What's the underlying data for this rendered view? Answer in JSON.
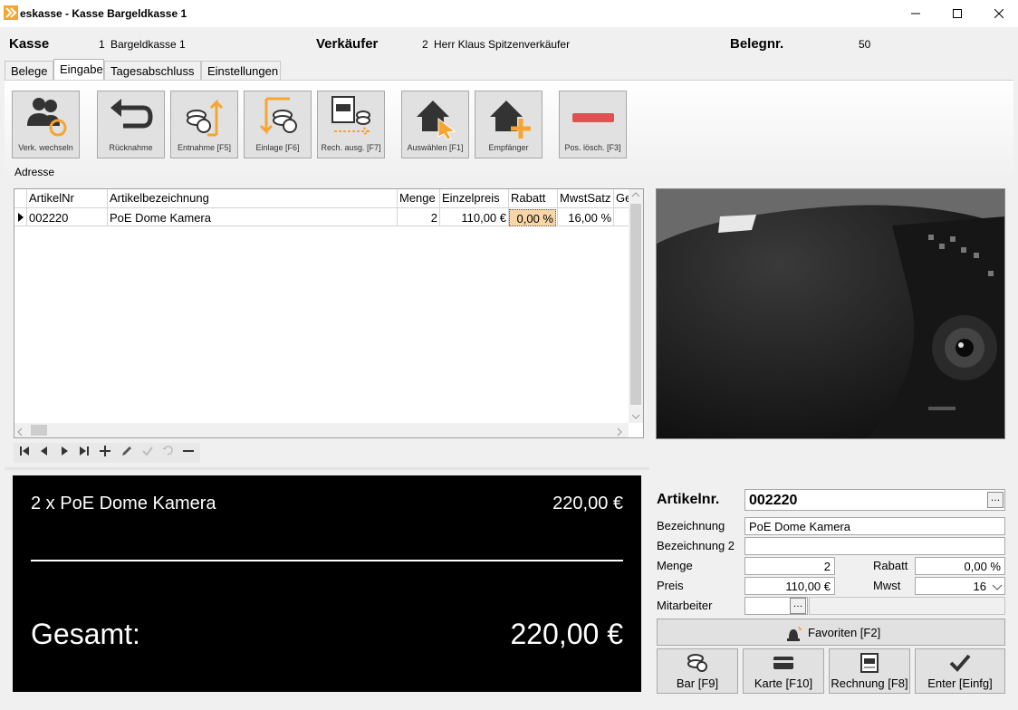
{
  "window": {
    "title": "eskasse - Kasse Bargeldkasse 1"
  },
  "header": {
    "kasse_label": "Kasse",
    "kasse_nr": "1",
    "kasse_name": "Bargeldkasse 1",
    "verkaeufer_label": "Verkäufer",
    "verkaeufer_nr": "2",
    "verkaeufer_name": "Herr Klaus Spitzenverkäufer",
    "belegnr_label": "Belegnr.",
    "belegnr_value": "50"
  },
  "tabs": [
    {
      "label": "Belege"
    },
    {
      "label": "Eingabe"
    },
    {
      "label": "Tagesabschluss"
    },
    {
      "label": "Einstellungen"
    }
  ],
  "toolbar": [
    {
      "label": "Verk. wechseln",
      "icon": "users-switch-icon"
    },
    {
      "label": "Rücknahme",
      "icon": "return-arrow-icon"
    },
    {
      "label": "Entnahme [F5]",
      "icon": "coins-out-icon"
    },
    {
      "label": "Einlage [F6]",
      "icon": "coins-in-icon"
    },
    {
      "label": "Rech. ausg. [F7]",
      "icon": "invoice-output-icon"
    },
    {
      "label": "Auswählen [F1]",
      "icon": "house-cursor-icon"
    },
    {
      "label": "Empfänger",
      "icon": "house-plus-icon"
    },
    {
      "label": "Pos. lösch. [F3]",
      "icon": "minus-icon"
    }
  ],
  "adresse_label": "Adresse",
  "grid": {
    "columns": [
      "ArtikelNr",
      "Artikelbezeichnung",
      "Menge",
      "Einzelpreis",
      "Rabatt",
      "MwstSatz",
      "Ge"
    ],
    "rows": [
      {
        "artikelnr": "002220",
        "bezeichnung": "PoE Dome Kamera",
        "menge": "2",
        "einzelpreis": "110,00 €",
        "rabatt": "0,00 %",
        "mwst": "16,00 %"
      }
    ]
  },
  "display": {
    "line_text": "2 x PoE Dome Kamera",
    "line_price": "220,00 €",
    "total_label": "Gesamt:",
    "total_value": "220,00 €"
  },
  "form": {
    "artikelnr_label": "Artikelnr.",
    "artikelnr_value": "002220",
    "bezeichnung_label": "Bezeichnung",
    "bezeichnung_value": "PoE Dome Kamera",
    "bezeichnung2_label": "Bezeichnung 2",
    "bezeichnung2_value": "",
    "menge_label": "Menge",
    "menge_value": "2",
    "rabatt_label": "Rabatt",
    "rabatt_value": "0,00 %",
    "preis_label": "Preis",
    "preis_value": "110,00 €",
    "mwst_label": "Mwst",
    "mwst_value": "16",
    "mitarbeiter_label": "Mitarbeiter",
    "mitarbeiter_value": ""
  },
  "buttons": {
    "favoriten": "Favoriten [F2]",
    "bar": "Bar [F9]",
    "karte": "Karte [F10]",
    "rechnung": "Rechnung [F8]",
    "enter": "Enter [Einfg]"
  },
  "colors": {
    "accent_orange": "#f6a530",
    "toolbar_icon_dark": "#333333",
    "minus_red": "#e05252",
    "rabatt_highlight": "#f8d6a8",
    "display_bg": "#000000"
  }
}
